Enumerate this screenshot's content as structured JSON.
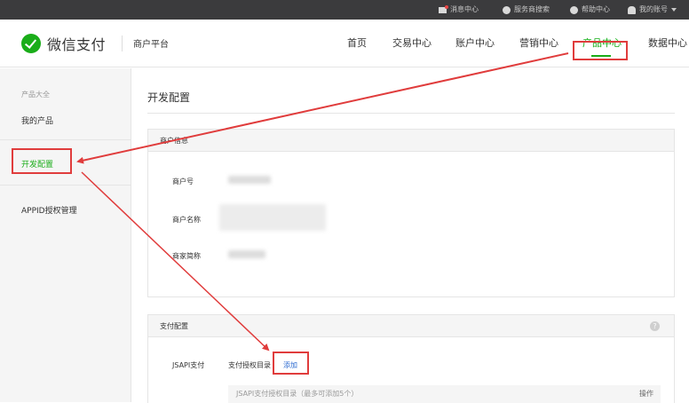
{
  "topbar": {
    "items": [
      {
        "label": "消息中心",
        "icon": "message-icon"
      },
      {
        "label": "服务商搜索",
        "icon": "search-circle-icon"
      },
      {
        "label": "帮助中心",
        "icon": "help-circle-icon"
      },
      {
        "label": "我的账号",
        "icon": "user-icon"
      }
    ]
  },
  "header": {
    "logo_text": "微信支付",
    "platform": "商户平台",
    "nav": [
      "首页",
      "交易中心",
      "账户中心",
      "营销中心",
      "产品中心",
      "数据中心"
    ],
    "active_nav": "产品中心"
  },
  "sidebar": {
    "section_label": "产品大全",
    "my_products": "我的产品",
    "dev_config": "开发配置",
    "appid_auth": "APPID授权管理"
  },
  "main": {
    "page_title": "开发配置",
    "merchant_panel": {
      "title": "商户信息",
      "merchant_id_label": "商户号",
      "merchant_name_label": "商户名称",
      "merchant_short_label": "商家简称"
    },
    "pay_panel": {
      "title": "支付配置",
      "help": "?",
      "jsapi_label": "JSAPI支付",
      "dir_label": "支付授权目录",
      "add_link": "添加",
      "table_header": "JSAPI支付授权目录（最多可添加5个）",
      "table_ops": "操作"
    }
  },
  "colors": {
    "brand_green": "#1aad19",
    "annotation_red": "#e03c3c",
    "link_blue": "#2b6ad0",
    "topbar_bg": "#3b3b3d"
  }
}
